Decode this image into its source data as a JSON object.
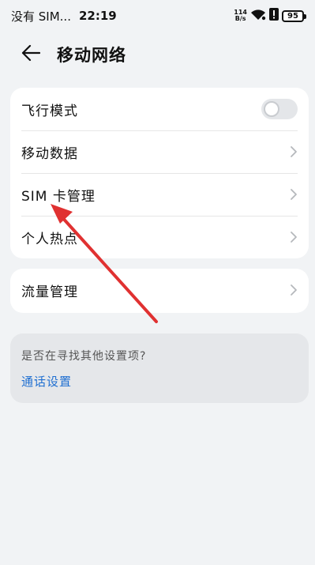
{
  "status_bar": {
    "carrier": "没有 SIM...",
    "time": "22:19",
    "net_speed_value": "114",
    "net_speed_unit": "B/s",
    "battery": "95"
  },
  "header": {
    "title": "移动网络",
    "back_icon": "arrow-left-icon"
  },
  "settings_group_1": {
    "items": [
      {
        "label": "飞行模式",
        "control": "toggle",
        "toggle_state": "off"
      },
      {
        "label": "移动数据",
        "control": "chevron"
      },
      {
        "label": "SIM 卡管理",
        "control": "chevron"
      },
      {
        "label": "个人热点",
        "control": "chevron"
      }
    ]
  },
  "settings_group_2": {
    "items": [
      {
        "label": "流量管理",
        "control": "chevron"
      }
    ]
  },
  "suggestion": {
    "question": "是否在寻找其他设置项?",
    "link": "通话设置"
  },
  "colors": {
    "background": "#f1f3f5",
    "card": "#ffffff",
    "link": "#1f6fd1",
    "annotation_arrow": "#e03131"
  }
}
